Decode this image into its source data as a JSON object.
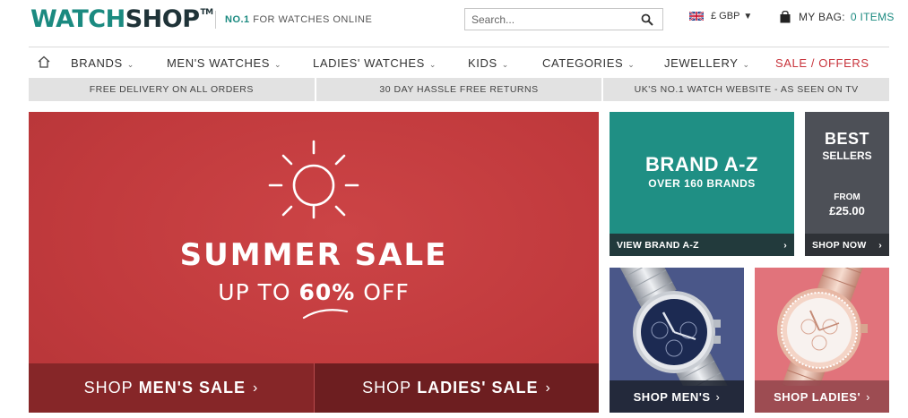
{
  "header": {
    "logo_part1": "WATCH",
    "logo_part2": "SHOP",
    "logo_tm": "TM",
    "tagline_no1": "NO.1",
    "tagline_rest": "FOR WATCHES ONLINE",
    "search_placeholder": "Search...",
    "currency": "£ GBP",
    "bag_label": "MY BAG:",
    "bag_count": "0 ITEMS"
  },
  "nav": {
    "items": [
      {
        "label": "BRANDS"
      },
      {
        "label": "MEN'S WATCHES"
      },
      {
        "label": "LADIES' WATCHES"
      },
      {
        "label": "KIDS"
      },
      {
        "label": "CATEGORIES"
      },
      {
        "label": "JEWELLERY"
      },
      {
        "label": "SALE / OFFERS"
      }
    ]
  },
  "infobar": [
    "FREE DELIVERY ON ALL ORDERS",
    "30 DAY HASSLE FREE RETURNS",
    "UK'S NO.1 WATCH WEBSITE - AS SEEN ON TV"
  ],
  "hero": {
    "title": "SUMMER SALE",
    "sub_prefix": "UP TO",
    "sub_bold": "60%",
    "sub_suffix": "OFF",
    "cta_mens_prefix": "SHOP",
    "cta_mens_bold": "MEN'S SALE",
    "cta_ladies_prefix": "SHOP",
    "cta_ladies_bold": "LADIES' SALE",
    "arrow": "›"
  },
  "brand_tile": {
    "title": "BRAND A-Z",
    "subtitle": "OVER 160 BRANDS",
    "link_prefix": "VIEW BRAND",
    "link_bold": "A-Z",
    "arrow": "›"
  },
  "best_tile": {
    "title": "BEST",
    "subtitle": "SELLERS",
    "from_label": "FROM",
    "price": "£25.00",
    "link": "SHOP NOW",
    "arrow": "›"
  },
  "mens_tile": {
    "label": "SHOP MEN'S",
    "arrow": "›"
  },
  "ladies_tile": {
    "label": "SHOP LADIES'",
    "arrow": "›"
  },
  "colors": {
    "brand_teal": "#1b8a80",
    "hero_red": "#c13a3d",
    "sale_red": "#c8333b",
    "brand_tile": "#1f8f84",
    "best_tile": "#4d5057",
    "mens_bg": "#4a5789",
    "ladies_bg": "#e1737b"
  }
}
